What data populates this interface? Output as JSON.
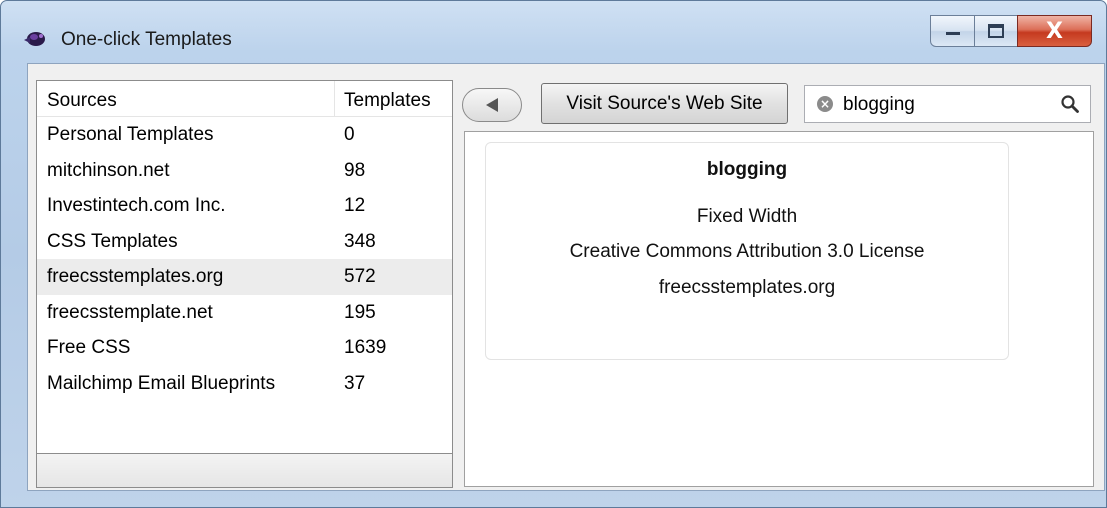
{
  "window": {
    "title": "One-click Templates",
    "close_glyph": "X"
  },
  "sources": {
    "header_name": "Sources",
    "header_count": "Templates",
    "rows": [
      {
        "name": "Personal Templates",
        "count": "0"
      },
      {
        "name": "mitchinson.net",
        "count": "98"
      },
      {
        "name": "Investintech.com Inc.",
        "count": "12"
      },
      {
        "name": "CSS Templates",
        "count": "348"
      },
      {
        "name": "freecsstemplates.org",
        "count": "572"
      },
      {
        "name": "freecsstemplate.net",
        "count": "195"
      },
      {
        "name": "Free CSS",
        "count": "1639"
      },
      {
        "name": "Mailchimp Email Blueprints",
        "count": "37"
      }
    ],
    "selected_row": 4
  },
  "toolbar": {
    "visit_label": "Visit Source's Web Site"
  },
  "search": {
    "value": "blogging"
  },
  "template_card": {
    "title": "blogging",
    "layout": "Fixed Width",
    "license": "Creative Commons Attribution 3.0 License",
    "source": "freecsstemplates.org"
  },
  "icons": {
    "app": "app-logo-icon",
    "minimize": "minimize-icon",
    "maximize": "maximize-icon",
    "close": "close-icon",
    "back": "back-arrow-icon",
    "clear": "clear-search-icon",
    "search": "search-icon"
  },
  "colors": {
    "selected_row": "#ececec",
    "close_button": "#c5391f",
    "title_bar": "#bcd3ec"
  }
}
